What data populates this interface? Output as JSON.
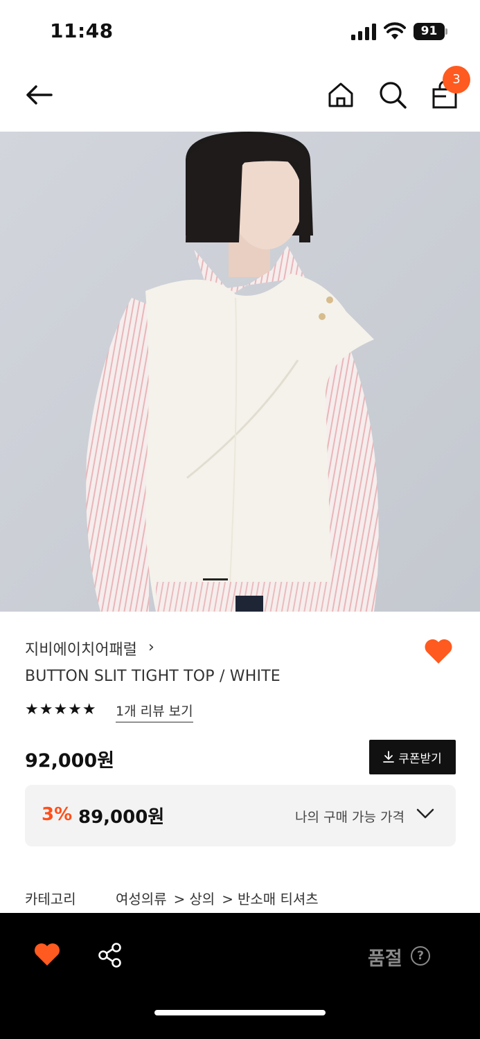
{
  "status_bar": {
    "time": "11:48",
    "battery": "91"
  },
  "nav": {
    "cart_count": "3",
    "icons": [
      "back-arrow-icon",
      "home-icon",
      "search-icon",
      "shopping-bag-icon"
    ]
  },
  "product": {
    "brand": "지비에이치어패럴",
    "brand_chevron": "›",
    "name": "BUTTON SLIT TIGHT TOP / WHITE",
    "stars": "★★★★★",
    "rating": 5,
    "review_link": "1개 리뷰 보기",
    "price": "92,000원",
    "coupon_button": "쿠폰받기",
    "discount_percent": "3%",
    "discount_price": "89,000원",
    "my_price_label": "나의 구매 가능 가격",
    "category_label": "카테고리",
    "category_path": [
      "여성의류",
      "상의",
      "반소매 티셔츠"
    ],
    "category_sep": ">"
  },
  "bottom_bar": {
    "soldout_label": "품절",
    "help": "?"
  },
  "colors": {
    "accent": "#ff5a1f",
    "dark": "#111111",
    "muted": "#8a8a8a"
  }
}
